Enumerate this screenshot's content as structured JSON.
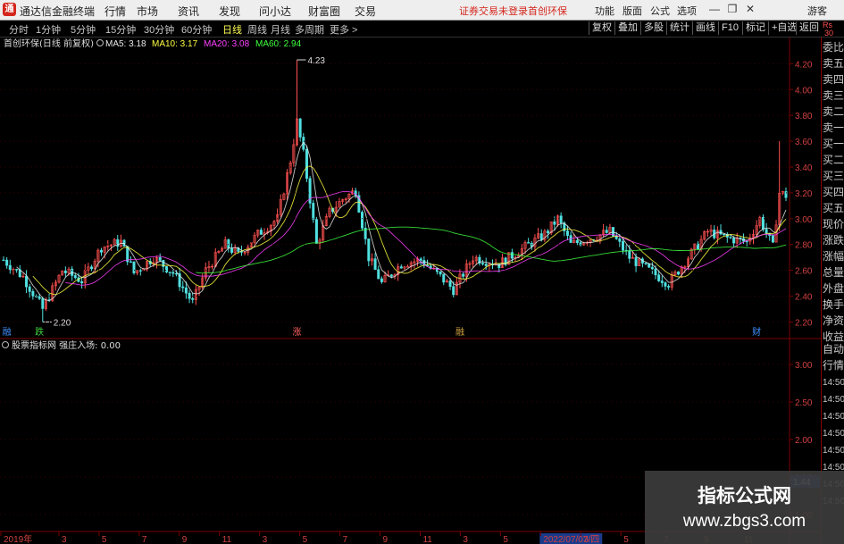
{
  "app": {
    "title": "通达信金融终端",
    "menu": [
      "行情",
      "市场",
      "资讯",
      "发现",
      "问小达",
      "财富圈",
      "交易"
    ],
    "notice": "证券交易未登录",
    "stock_tag": "首创环保",
    "right_menu": [
      "功能",
      "版面",
      "公式",
      "选项"
    ],
    "guest": "游客"
  },
  "toolbar": {
    "periods": [
      "分时",
      "1分钟",
      "5分钟",
      "15分钟",
      "30分钟",
      "60分钟",
      "日线",
      "周线",
      "月线",
      "多周期",
      "更多 >"
    ],
    "active": "日线",
    "right_buttons": [
      "复权",
      "叠加",
      "多股",
      "统计",
      "画线",
      "F10",
      "标记",
      "+自选",
      "返回"
    ]
  },
  "side_panel": [
    "委比",
    "卖五",
    "卖四",
    "卖三",
    "卖二",
    "卖一",
    "买一",
    "买二",
    "买三",
    "买四",
    "买五",
    "现价",
    "涨跌",
    "涨幅",
    "总量",
    "外盘",
    "换手",
    "净资",
    "收益",
    "自动",
    "行情",
    "14:50",
    "14:50",
    "14:50",
    "14:50",
    "14:50",
    "14:50",
    "14:50",
    "14:50"
  ],
  "side_header": [
    "Rs",
    "30"
  ],
  "colors": {
    "bg": "#000000",
    "grid": "#7a0000",
    "up": "#ff5050",
    "down": "#50e0e0",
    "ma5": "#e8e8e8",
    "ma10": "#ffff40",
    "ma20": "#ff40ff",
    "ma60": "#40ff40",
    "axis_text": "#c8c8c8",
    "current_price_box": "#1a3a8a"
  },
  "chart_data": [
    {
      "type": "candlestick",
      "title": "首创环保(日线 前复权)",
      "legend": [
        {
          "name": "MA5",
          "value": "3.18",
          "color": "#e8e8e8"
        },
        {
          "name": "MA10",
          "value": "3.17",
          "color": "#ffff40"
        },
        {
          "name": "MA20",
          "value": "3.08",
          "color": "#ff40ff"
        },
        {
          "name": "MA60",
          "value": "2.94",
          "color": "#40ff40"
        }
      ],
      "ylim": [
        2.12,
        4.32
      ],
      "yticks": [
        "4.20",
        "4.00",
        "3.80",
        "3.60",
        "3.40",
        "3.20",
        "3.00",
        "2.80",
        "2.60",
        "2.40",
        "2.20"
      ],
      "annotations": [
        {
          "label": "4.23",
          "x_index": 90,
          "value": 4.23
        },
        {
          "label": "2.20",
          "x_index": 12,
          "value": 2.2
        }
      ],
      "anchors": [
        [
          0,
          2.68
        ],
        [
          6,
          2.55
        ],
        [
          12,
          2.3
        ],
        [
          18,
          2.6
        ],
        [
          24,
          2.52
        ],
        [
          30,
          2.78
        ],
        [
          36,
          2.82
        ],
        [
          40,
          2.58
        ],
        [
          46,
          2.7
        ],
        [
          52,
          2.58
        ],
        [
          58,
          2.35
        ],
        [
          62,
          2.6
        ],
        [
          68,
          2.8
        ],
        [
          72,
          2.72
        ],
        [
          78,
          2.88
        ],
        [
          84,
          3.0
        ],
        [
          88,
          3.45
        ],
        [
          90,
          3.75
        ],
        [
          92,
          3.5
        ],
        [
          96,
          2.8
        ],
        [
          100,
          3.05
        ],
        [
          104,
          3.15
        ],
        [
          108,
          3.22
        ],
        [
          112,
          2.7
        ],
        [
          116,
          2.5
        ],
        [
          122,
          2.65
        ],
        [
          128,
          2.68
        ],
        [
          134,
          2.55
        ],
        [
          138,
          2.45
        ],
        [
          144,
          2.7
        ],
        [
          152,
          2.65
        ],
        [
          160,
          2.78
        ],
        [
          166,
          2.88
        ],
        [
          170,
          3.0
        ],
        [
          174,
          2.8
        ],
        [
          180,
          2.85
        ],
        [
          186,
          2.9
        ],
        [
          192,
          2.7
        ],
        [
          198,
          2.6
        ],
        [
          204,
          2.5
        ],
        [
          210,
          2.7
        ],
        [
          216,
          2.9
        ],
        [
          222,
          2.85
        ],
        [
          228,
          2.82
        ],
        [
          232,
          3.0
        ],
        [
          236,
          2.78
        ],
        [
          238,
          3.2
        ],
        [
          240,
          3.18
        ]
      ],
      "total_points": 241,
      "bottom_labels": [
        {
          "text": "融",
          "x_index": 1,
          "color": "#4090ff"
        },
        {
          "text": "跌",
          "x_index": 11,
          "color": "#40d040"
        },
        {
          "text": "涨",
          "x_index": 90,
          "color": "#ff6060"
        },
        {
          "text": "融",
          "x_index": 140,
          "color": "#d0a040"
        },
        {
          "text": "财",
          "x_index": 231,
          "color": "#4090ff"
        }
      ]
    },
    {
      "type": "line",
      "title": "股票指标网 强庄入场: 0.00",
      "ylim": [
        0.75,
        3.25
      ],
      "yticks": [
        "3.00",
        "2.50",
        "2.00",
        "1.50",
        "1.00"
      ],
      "current_value": "1.44",
      "values": []
    }
  ],
  "xaxis": {
    "labels": [
      "2019年",
      "3",
      "5",
      "7",
      "9",
      "11",
      "3",
      "5",
      "7",
      "9",
      "11",
      "3",
      "5",
      "2022/07/07/四",
      "3",
      "5",
      "7",
      "9",
      "11"
    ]
  },
  "watermark": {
    "line1": "指标公式网",
    "line2": "www.zbgs3.com"
  }
}
